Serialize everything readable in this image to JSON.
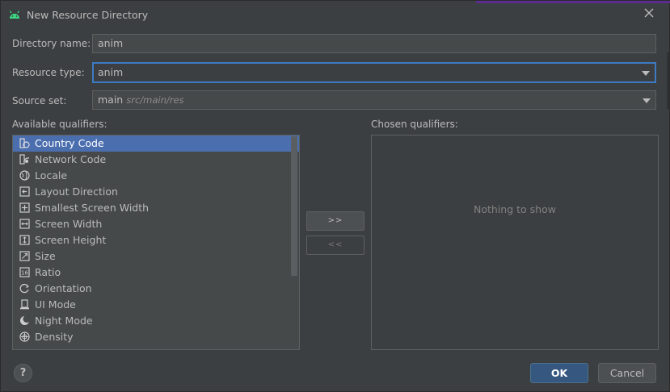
{
  "window": {
    "title": "New Resource Directory",
    "icon": "android-icon"
  },
  "form": {
    "directory_name": {
      "label": "Directory name:",
      "value": "anim"
    },
    "resource_type": {
      "label": "Resource type:",
      "value": "anim"
    },
    "source_set": {
      "label": "Source set:",
      "value": "main",
      "hint": "src/main/res"
    }
  },
  "available": {
    "label": "Available qualifiers:",
    "items": [
      {
        "label": "Country Code",
        "icon": "country-code-icon",
        "selected": true
      },
      {
        "label": "Network Code",
        "icon": "network-code-icon"
      },
      {
        "label": "Locale",
        "icon": "globe-icon"
      },
      {
        "label": "Layout Direction",
        "icon": "layout-direction-icon"
      },
      {
        "label": "Smallest Screen Width",
        "icon": "smallest-width-icon"
      },
      {
        "label": "Screen Width",
        "icon": "screen-width-icon"
      },
      {
        "label": "Screen Height",
        "icon": "screen-height-icon"
      },
      {
        "label": "Size",
        "icon": "size-icon"
      },
      {
        "label": "Ratio",
        "icon": "ratio-icon"
      },
      {
        "label": "Orientation",
        "icon": "orientation-icon"
      },
      {
        "label": "UI Mode",
        "icon": "ui-mode-icon"
      },
      {
        "label": "Night Mode",
        "icon": "night-mode-icon"
      },
      {
        "label": "Density",
        "icon": "density-icon"
      }
    ]
  },
  "transfer": {
    "add_label": ">>",
    "remove_label": "<<"
  },
  "chosen": {
    "label": "Chosen qualifiers:",
    "empty_text": "Nothing to show"
  },
  "buttons": {
    "help": "?",
    "ok": "OK",
    "cancel": "Cancel"
  },
  "colors": {
    "background": "#3c3f41",
    "field": "#45494a",
    "selection": "#4b6eaf",
    "focus_border": "#3d7ac4",
    "primary_button": "#365880"
  }
}
